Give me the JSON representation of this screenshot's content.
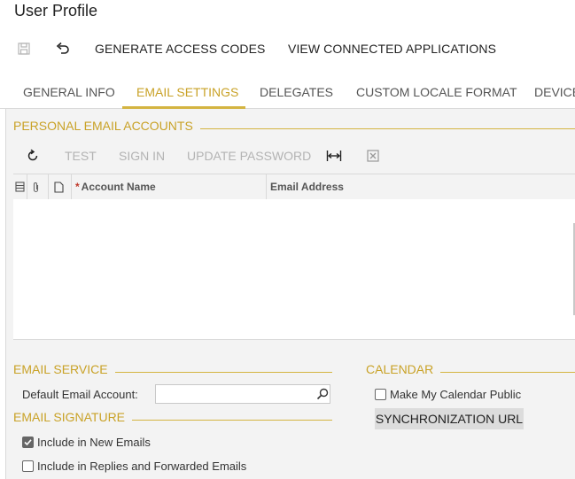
{
  "page": {
    "title": "User Profile"
  },
  "toolbar": {
    "save_icon": "save-icon",
    "undo_icon": "undo-icon",
    "generate_access_codes": "GENERATE ACCESS CODES",
    "view_connected_applications": "VIEW CONNECTED APPLICATIONS"
  },
  "tabs": [
    {
      "label": "GENERAL INFO",
      "active": false
    },
    {
      "label": "EMAIL SETTINGS",
      "active": true
    },
    {
      "label": "DELEGATES",
      "active": false
    },
    {
      "label": "CUSTOM LOCALE FORMAT",
      "active": false
    },
    {
      "label": "DEVICES",
      "active": false
    }
  ],
  "personal_email_accounts": {
    "title": "PERSONAL EMAIL ACCOUNTS",
    "toolbar": {
      "refresh_icon": "refresh-icon",
      "test": "TEST",
      "sign_in": "SIGN IN",
      "update_password": "UPDATE PASSWORD",
      "fit_columns_icon": "fit-columns-icon",
      "export_excel_icon": "export-excel-icon"
    },
    "grid": {
      "columns": [
        {
          "label": "Account Name",
          "required": true,
          "required_mark": "*"
        },
        {
          "label": "Email Address",
          "required": false
        }
      ],
      "rows": []
    }
  },
  "email_service": {
    "title": "EMAIL SERVICE",
    "default_email_account_label": "Default Email Account:",
    "default_email_account_value": ""
  },
  "email_signature": {
    "title": "EMAIL SIGNATURE",
    "include_in_new_emails": {
      "label": "Include in New Emails",
      "checked": true
    },
    "include_in_replies": {
      "label": "Include in Replies and Forwarded Emails",
      "checked": false
    }
  },
  "calendar": {
    "title": "CALENDAR",
    "make_public": {
      "label": "Make My Calendar Public",
      "checked": false
    },
    "sync_url_button": "SYNCHRONIZATION URL"
  },
  "colors": {
    "accent": "#c9a227",
    "panel": "#f3f3f3",
    "border": "#d9d9d9"
  }
}
